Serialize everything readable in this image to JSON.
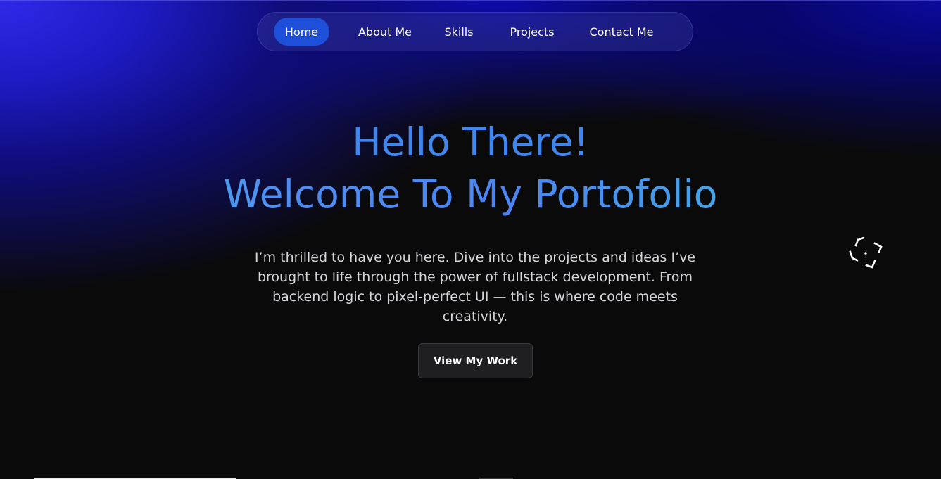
{
  "nav": {
    "items": [
      {
        "label": "Home",
        "active": true
      },
      {
        "label": "About Me",
        "active": false
      },
      {
        "label": "Skills",
        "active": false
      },
      {
        "label": "Projects",
        "active": false
      },
      {
        "label": "Contact Me",
        "active": false
      }
    ]
  },
  "hero": {
    "title_line1": "Hello There!",
    "title_line2": "Welcome To My Portofolio",
    "description": "I’m thrilled to have you here. Dive into the projects and ideas I’ve brought to life through the power of fullstack development. From backend logic to pixel-perfect UI — this is where code meets creativity.",
    "cta_label": "View My Work"
  },
  "icons": {
    "focus": "focus-frame-icon"
  },
  "colors": {
    "accent_blue": "#1e4fd8",
    "title_blue": "#3f86ee",
    "gradient_teal": "#3cc3d8",
    "background": "#0a0a0b",
    "glow_indigo": "#2d2ae8"
  }
}
